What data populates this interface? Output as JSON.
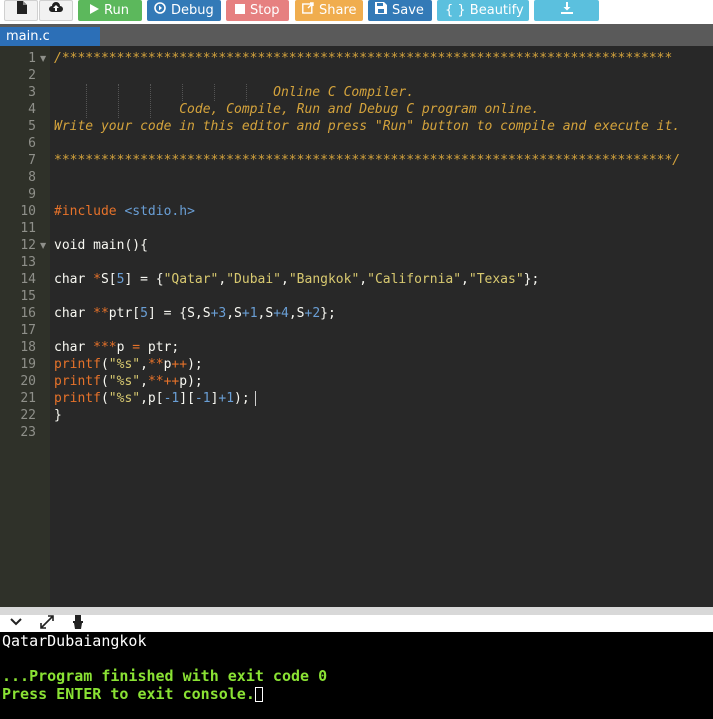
{
  "toolbar": {
    "new_icon": "file-icon",
    "upload_icon": "upload-icon",
    "run_label": "Run",
    "debug_label": "Debug",
    "stop_label": "Stop",
    "share_label": "Share",
    "save_label": "Save",
    "beautify_label": "{ } Beautify",
    "download_icon": "download-icon"
  },
  "tab": {
    "label": "main.c"
  },
  "editor": {
    "line_numbers": [
      "1",
      "2",
      "3",
      "4",
      "5",
      "6",
      "7",
      "8",
      "9",
      "10",
      "11",
      "12",
      "13",
      "14",
      "15",
      "16",
      "17",
      "18",
      "19",
      "20",
      "21",
      "22",
      "23"
    ],
    "lines": {
      "l1": "/******************************************************************************",
      "l3": "                            Online C Compiler.",
      "l4": "                Code, Compile, Run and Debug C program online.",
      "l5": "Write your code in this editor and press \"Run\" button to compile and execute it.",
      "l7": "*******************************************************************************/",
      "l10_pp": "#include",
      "l10_inc": "<stdio.h>",
      "l12": "void main(){",
      "l14_a": "char ",
      "l14_b": "*",
      "l14_c": "S[",
      "l14_d": "5",
      "l14_e": "] = {",
      "l14_s1": "\"Qatar\"",
      "l14_s2": "\"Dubai\"",
      "l14_s3": "\"Bangkok\"",
      "l14_s4": "\"California\"",
      "l14_s5": "\"Texas\"",
      "l14_end": "};",
      "l16_a": "char ",
      "l16_b": "**",
      "l16_c": "ptr[",
      "l16_d": "5",
      "l16_e": "] = {S,S",
      "l16_f": "+3",
      "l16_g": ",S",
      "l16_h": "+1",
      "l16_i": ",S",
      "l16_j": "+4",
      "l16_k": ",S",
      "l16_l": "+2",
      "l16_m": "};",
      "l18_a": "char ",
      "l18_b": "***",
      "l18_c": "p ",
      "l18_d": "=",
      "l18_e": " ptr;",
      "l19_fn": "printf",
      "l19_a": "(",
      "l19_s": "\"%s\"",
      "l19_b": ",",
      "l19_c": "**",
      "l19_d": "p",
      "l19_e": "++",
      "l19_f": ");",
      "l20_fn": "printf",
      "l20_a": "(",
      "l20_s": "\"%s\"",
      "l20_b": ",",
      "l20_c": "**++",
      "l20_d": "p);",
      "l21_fn": "printf",
      "l21_a": "(",
      "l21_s": "\"%s\"",
      "l21_b": ",p[",
      "l21_c": "-1",
      "l21_d": "][",
      "l21_e": "-1",
      "l21_f": "]",
      "l21_g": "+1",
      "l21_h": ");",
      "l22": "}"
    }
  },
  "console_bar": {
    "collapse_icon": "chevron-down-icon",
    "expand_icon": "expand-icon",
    "clear_icon": "clear-console-icon"
  },
  "console": {
    "output": "QatarDubaiangkok",
    "finished": "...Program finished with exit code 0",
    "prompt": "Press ENTER to exit console."
  }
}
